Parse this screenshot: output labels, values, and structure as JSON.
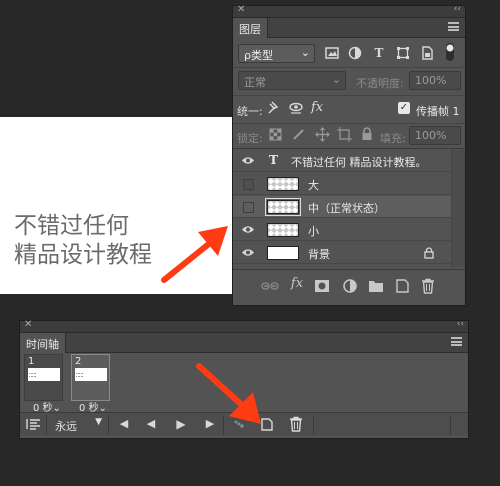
{
  "canvas": {
    "line1": "不错过任何",
    "line2": "精品设计教程"
  },
  "layers_panel": {
    "title": "图层",
    "filter": {
      "label": "ρ类型",
      "chevron": "⌄"
    },
    "blend_mode": "正常",
    "opacity_label": "不透明度:",
    "opacity_value": "100%",
    "unify_label": "统一:",
    "propagate_label": "传播帧 1",
    "propagate_checked": true,
    "lock_label": "锁定:",
    "fill_label": "填充:",
    "fill_value": "100%",
    "layers": [
      {
        "name": "不错过任何 精品设计教程。",
        "kind": "text",
        "visible": true,
        "selected": false
      },
      {
        "name": "大",
        "kind": "image",
        "visible": false,
        "selected": false
      },
      {
        "name": "中（正常状态）",
        "kind": "image",
        "visible": false,
        "selected": true
      },
      {
        "name": "小",
        "kind": "image",
        "visible": true,
        "selected": false
      },
      {
        "name": "背景",
        "kind": "background",
        "visible": true,
        "selected": false,
        "locked": true
      }
    ]
  },
  "timeline_panel": {
    "title": "时间轴",
    "frames": [
      {
        "number": "1",
        "delay": "0 秒",
        "selected": false
      },
      {
        "number": "2",
        "delay": "0 秒",
        "selected": true
      }
    ],
    "loop_value": "永远"
  },
  "colors": {
    "arrow": "#ff3b14",
    "panel_bg": "#535353",
    "app_bg": "#282828"
  }
}
